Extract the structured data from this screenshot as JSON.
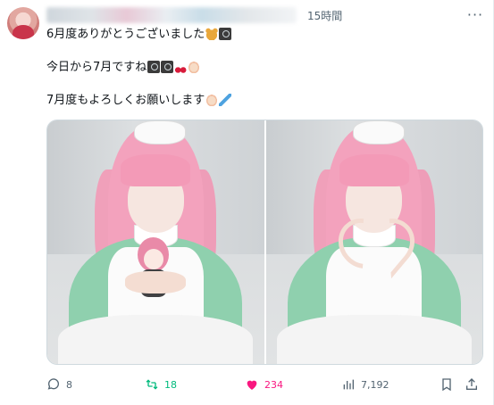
{
  "post": {
    "author_name_blurred": "",
    "time": "15時間",
    "more_label": "···",
    "lines": [
      "6月度ありがとうございました",
      "今日から7月ですね",
      "7月度もよろしくお願いします"
    ],
    "emoji": {
      "line1": [
        "bear-emoji",
        "camera-emoji"
      ],
      "line2": [
        "camera-emoji",
        "camera-emoji",
        "cherries-emoji",
        "heart-hands-emoji"
      ],
      "line3": [
        "heart-hands-emoji",
        "kite-emoji"
      ]
    }
  },
  "media": {
    "photos": [
      "photo-1",
      "photo-2"
    ]
  },
  "actions": {
    "reply_count": "8",
    "retweet_count": "18",
    "like_count": "234",
    "views_count": "7,192"
  },
  "colors": {
    "retweet": "#00ba7c",
    "like": "#f91880",
    "muted": "#536471",
    "text": "#0f1419"
  }
}
